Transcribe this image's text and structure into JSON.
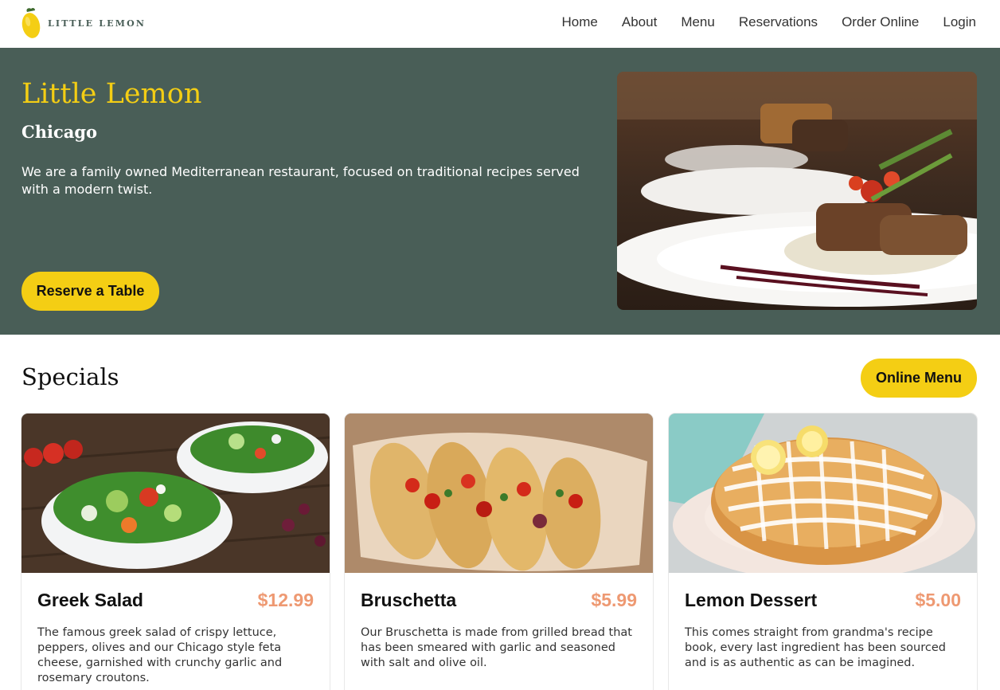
{
  "brand": {
    "logo_text": "LITTLE LEMON",
    "accent": "#f4ce14",
    "primary": "#495e57",
    "price_color": "#ee9972"
  },
  "nav": {
    "items": [
      {
        "label": "Home"
      },
      {
        "label": "About"
      },
      {
        "label": "Menu"
      },
      {
        "label": "Reservations"
      },
      {
        "label": "Order Online"
      },
      {
        "label": "Login"
      }
    ]
  },
  "hero": {
    "title": "Little Lemon",
    "city": "Chicago",
    "description": "We are a family owned Mediterranean restaurant, focused on traditional recipes served with a modern twist.",
    "button_label": "Reserve a Table",
    "image_icon": "restaurant-dish-photo"
  },
  "specials": {
    "title": "Specials",
    "button_label": "Online Menu",
    "cards": [
      {
        "name": "Greek Salad",
        "price": "$12.99",
        "description": "The famous greek salad of crispy lettuce, peppers, olives and our Chicago style feta cheese, garnished with crunchy garlic and rosemary croutons.",
        "image_icon": "greek-salad-photo"
      },
      {
        "name": "Bruschetta",
        "price": "$5.99",
        "description": "Our Bruschetta is made from grilled bread that has been smeared with garlic and seasoned with salt and olive oil.",
        "image_icon": "bruschetta-photo"
      },
      {
        "name": "Lemon Dessert",
        "price": "$5.00",
        "description": "This comes straight from grandma's recipe book, every last ingredient has been sourced and is as authentic as can be imagined.",
        "image_icon": "lemon-dessert-photo"
      }
    ]
  }
}
